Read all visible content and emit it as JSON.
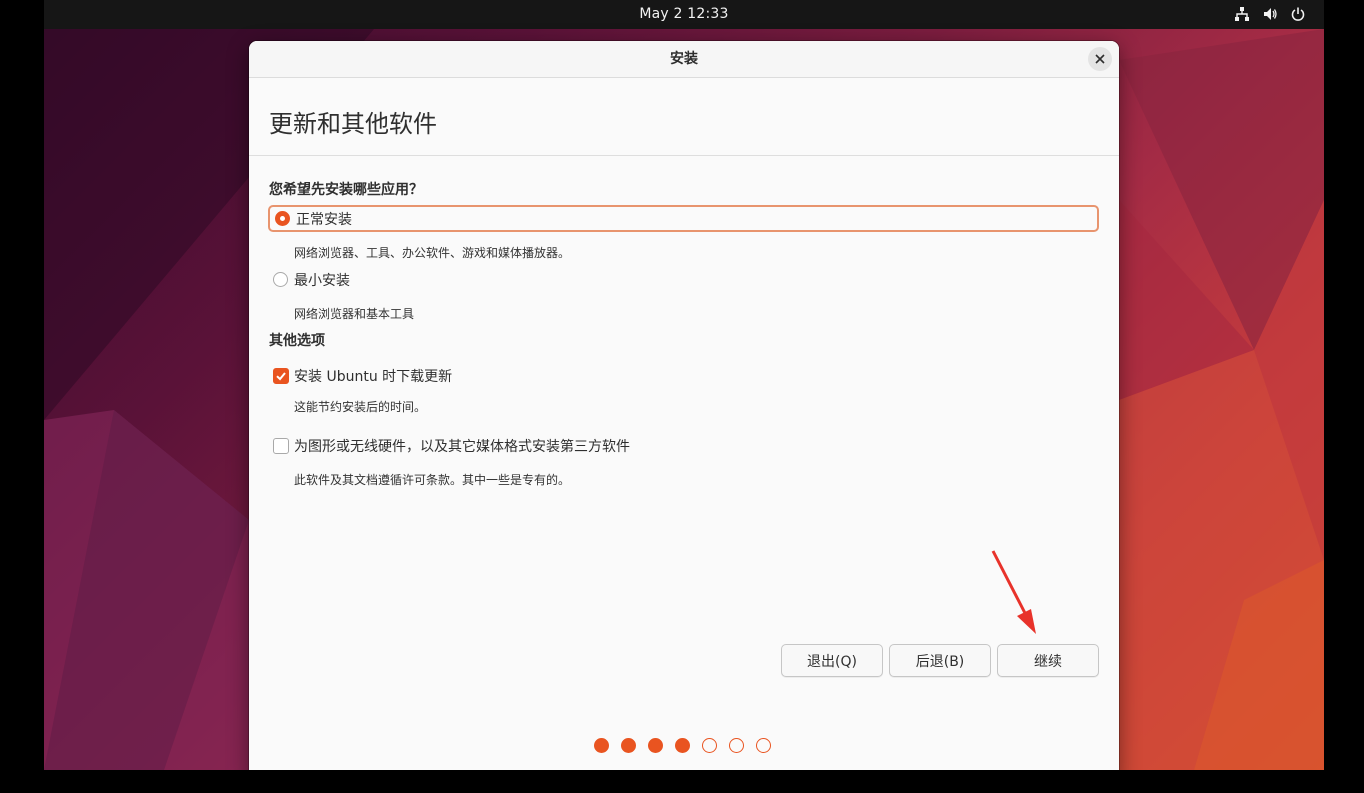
{
  "topbar": {
    "clock": "May 2  12:33"
  },
  "window": {
    "title": "安装",
    "page_title": "更新和其他软件",
    "apps_section": {
      "title": "您希望先安装哪些应用？",
      "options": [
        {
          "label": "正常安装",
          "description": "网络浏览器、工具、办公软件、游戏和媒体播放器。",
          "selected": true
        },
        {
          "label": "最小安装",
          "description": "网络浏览器和基本工具",
          "selected": false
        }
      ]
    },
    "other_section": {
      "title": "其他选项",
      "options": [
        {
          "label": "安装 Ubuntu 时下载更新",
          "description": "这能节约安装后的时间。",
          "checked": true
        },
        {
          "label": "为图形或无线硬件，以及其它媒体格式安装第三方软件",
          "description": "此软件及其文档遵循许可条款。其中一些是专有的。",
          "checked": false
        }
      ]
    },
    "buttons": {
      "quit": "退出(Q)",
      "back": "后退(B)",
      "continue": "继续"
    },
    "progress": {
      "total_steps": 7,
      "completed_steps": 4
    }
  },
  "colors": {
    "accent": "#e95420",
    "annotation_arrow": "#e8322a"
  }
}
